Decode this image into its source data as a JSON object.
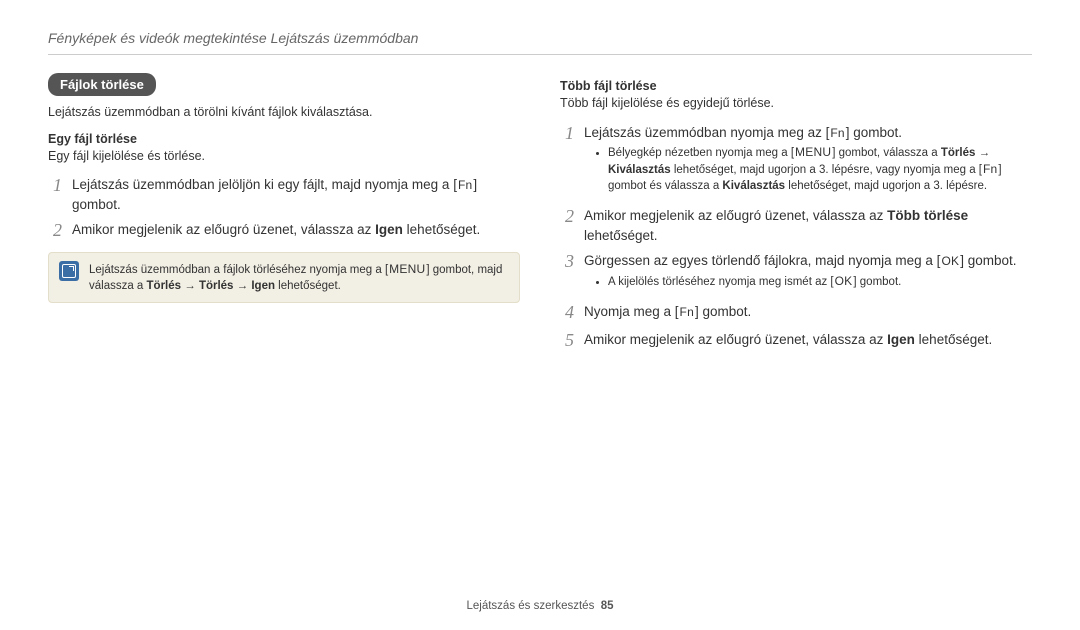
{
  "header": "Fényképek és videók megtekintése Lejátszás üzemmódban",
  "footer": {
    "section": "Lejátszás és szerkesztés",
    "page": "85"
  },
  "keys": {
    "fn": "Fn",
    "menu": "MENU",
    "ok": "OK"
  },
  "left": {
    "pill": "Fájlok törlése",
    "intro": "Lejátszás üzemmódban a törölni kívánt fájlok kiválasztása.",
    "sub1_title": "Egy fájl törlése",
    "sub1_intro": "Egy fájl kijelölése és törlése.",
    "step1_a": "Lejátszás üzemmódban jelöljön ki egy fájlt, majd nyomja meg a [",
    "step1_b": "] gombot.",
    "step2_a": "Amikor megjelenik az előugró üzenet, válassza az ",
    "step2_bold": "Igen",
    "step2_b": " lehetőséget.",
    "note_a": "Lejátszás üzemmódban a fájlok törléséhez nyomja meg a [",
    "note_b": "] gombot, majd válassza a ",
    "note_del1": "Törlés",
    "note_del2": "Törlés",
    "note_igen": "Igen",
    "note_c": " lehetőséget."
  },
  "right": {
    "sub_title": "Több fájl törlése",
    "sub_intro": "Több fájl kijelölése és egyidejű törlése.",
    "s1_a": "Lejátszás üzemmódban nyomja meg az [",
    "s1_b": "] gombot.",
    "b1_a": "Bélyegkép nézetben nyomja meg a [",
    "b1_b": "] gombot, válassza a ",
    "b1_bold1": "Törlés",
    "b1_arrow": " → ",
    "b1_bold2": "Kiválasztás",
    "b1_c": " lehetőséget, majd ugorjon a 3. lépésre, vagy nyomja meg a [",
    "b1_d": "] gombot és válassza a ",
    "b1_bold3": "Kiválasztás",
    "b1_e": " lehetőséget, majd ugorjon a 3. lépésre.",
    "s2_a": "Amikor megjelenik az előugró üzenet, válassza az ",
    "s2_bold": "Több törlése",
    "s2_b": " lehetőséget.",
    "s3_a": "Görgessen az egyes törlendő fájlokra, majd nyomja meg a [",
    "s3_b": "] gombot.",
    "b2_a": "A kijelölés törléséhez nyomja meg ismét az [",
    "b2_b": "] gombot.",
    "s4_a": "Nyomja meg a [",
    "s4_b": "] gombot.",
    "s5_a": "Amikor megjelenik az előugró üzenet, válassza az ",
    "s5_bold": "Igen",
    "s5_b": " lehetőséget."
  }
}
